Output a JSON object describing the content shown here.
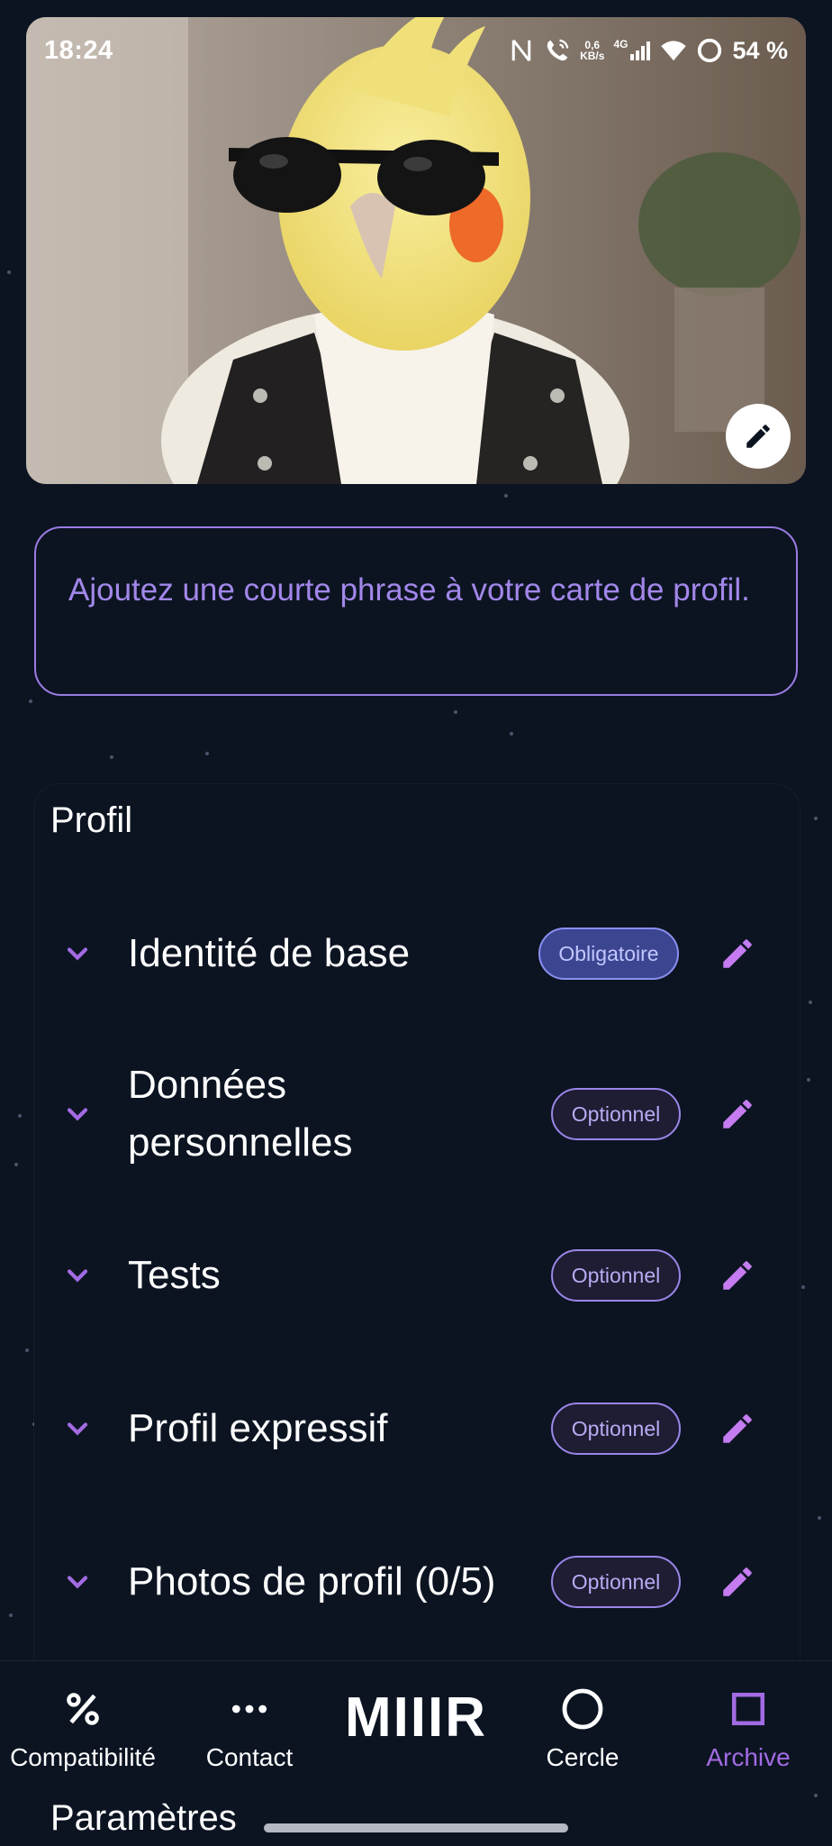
{
  "status_bar": {
    "time": "18:24",
    "network_speed_value": "0,6",
    "network_speed_unit": "KB/s",
    "network_type": "4G",
    "battery": "54 %"
  },
  "header": {
    "edit_icon": "pencil-icon"
  },
  "tagline": {
    "placeholder": "Ajoutez une courte phrase à votre carte de profil."
  },
  "profile": {
    "title": "Profil",
    "sections": [
      {
        "label": "Identité de base",
        "badge": "Obligatoire",
        "badge_type": "mandatory"
      },
      {
        "label": "Données personnelles",
        "badge": "Optionnel",
        "badge_type": "optional"
      },
      {
        "label": "Tests",
        "badge": "Optionnel",
        "badge_type": "optional"
      },
      {
        "label": "Profil expressif",
        "badge": "Optionnel",
        "badge_type": "optional"
      },
      {
        "label": "Photos de profil (0/5)",
        "badge": "Optionnel",
        "badge_type": "optional"
      }
    ]
  },
  "bottom_nav": {
    "brand": "MIIIR",
    "items": [
      {
        "label": "Compatibilité",
        "icon": "percent-icon",
        "active": false
      },
      {
        "label": "Contact",
        "icon": "more-dots-icon",
        "active": false
      },
      {
        "label": "Cercle",
        "icon": "circle-icon",
        "active": false
      },
      {
        "label": "Archive",
        "icon": "square-icon",
        "active": true
      }
    ]
  },
  "settings": {
    "label": "Paramètres"
  },
  "colors": {
    "background": "#0c1422",
    "accent": "#a26be3",
    "tagline_text": "#a287ea",
    "pencil": "#c47cf0"
  }
}
